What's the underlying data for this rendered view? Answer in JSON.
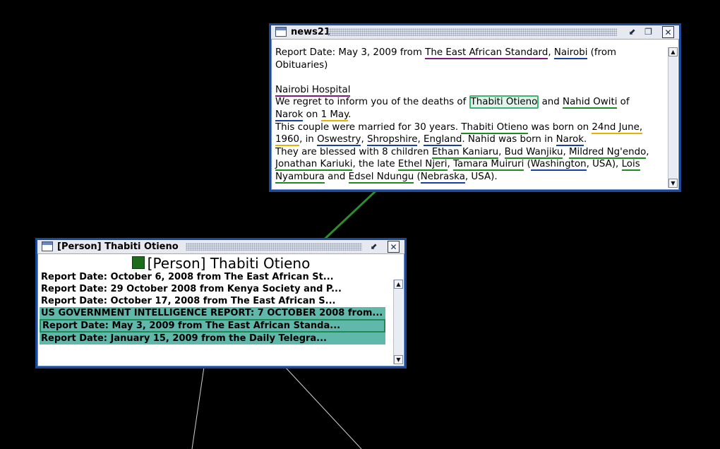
{
  "news_window": {
    "title": "news21",
    "lines": [
      [
        "Report Date:   May 3, 2009 from ",
        {
          "t": "The East African Standard",
          "c": "pur"
        },
        ", ",
        {
          "t": "Nairobi",
          "c": "blu"
        },
        " (from"
      ],
      [
        "Obituaries)"
      ],
      [
        ""
      ],
      [
        {
          "t": "Nairobi Hospital",
          "c": "pur"
        }
      ],
      [
        "We regret to inform you of the deaths of ",
        {
          "t": "Thabiti Otieno",
          "c": "hl"
        },
        " and ",
        {
          "t": "Nahid Owiti",
          "c": "grn"
        },
        " of"
      ],
      [
        {
          "t": "Narok",
          "c": "blu"
        },
        " on ",
        {
          "t": "1 May",
          "c": "yel"
        },
        "."
      ],
      [
        "This couple were married for 30 years. ",
        {
          "t": "Thabiti Otieno",
          "c": "grn"
        },
        " was born on ",
        {
          "t": "24nd June,",
          "c": "yel"
        }
      ],
      [
        {
          "t": "1960",
          "c": "yel"
        },
        ", in ",
        {
          "t": "Oswestry",
          "c": "blu"
        },
        ", ",
        {
          "t": "Shropshire",
          "c": "blu"
        },
        ", ",
        {
          "t": "England",
          "c": "blu"
        },
        ". Nahid was born in ",
        {
          "t": "Narok",
          "c": "blu"
        },
        "."
      ],
      [
        "They are blessed with 8 children ",
        {
          "t": "Ethan Kaniaru",
          "c": "grn"
        },
        ", ",
        {
          "t": "Bud Wanjiku",
          "c": "grn"
        },
        ", ",
        {
          "t": "Mildred Ng'endo",
          "c": "grn"
        },
        ","
      ],
      [
        {
          "t": "Jonathan Kariuki",
          "c": "grn"
        },
        ", the late ",
        {
          "t": "Ethel Njeri",
          "c": "grn"
        },
        ", ",
        {
          "t": "Tamara Muiruri",
          "c": "grn"
        },
        " (",
        {
          "t": "Washington",
          "c": "blu"
        },
        ", USA), ",
        {
          "t": "Lois",
          "c": "grn"
        }
      ],
      [
        {
          "t": "Nyambura",
          "c": "grn"
        },
        " and ",
        {
          "t": "Edsel Ndungu",
          "c": "grn"
        },
        " (",
        {
          "t": "Nebraska",
          "c": "blu"
        },
        ", USA)."
      ]
    ]
  },
  "person_window": {
    "title": "[Person] Thabiti Otieno",
    "header": "[Person] Thabiti Otieno",
    "rows": [
      {
        "text": "Report Date:   October 6, 2008 from The East African St...",
        "style": ""
      },
      {
        "text": "Report Date:  29 October 2008  from Kenya Society and P...",
        "style": ""
      },
      {
        "text": "Report Date:   October 17, 2008 from The East African S...",
        "style": ""
      },
      {
        "text": "US GOVERNMENT INTELLIGENCE REPORT: 7 OCTOBER 2008  from...",
        "style": "teal"
      },
      {
        "text": "Report Date:   May 3, 2009 from The East African Standa...",
        "style": "sel"
      },
      {
        "text": "Report Date:   January 15, 2009  from the Daily Telegra...",
        "style": "teal"
      }
    ]
  },
  "icons": {
    "window_icon": "window-icon",
    "minimize": "minimize-icon",
    "maximize": "maximize-icon",
    "close": "close-icon",
    "scroll_up": "scroll-up-icon",
    "scroll_down": "scroll-down-icon"
  },
  "colors": {
    "background": "#000000",
    "window_border": "#1c4a98",
    "link_line": "#2e8b2e",
    "person_square": "#1d6b1d",
    "row_highlight": "#5fb8aa"
  }
}
